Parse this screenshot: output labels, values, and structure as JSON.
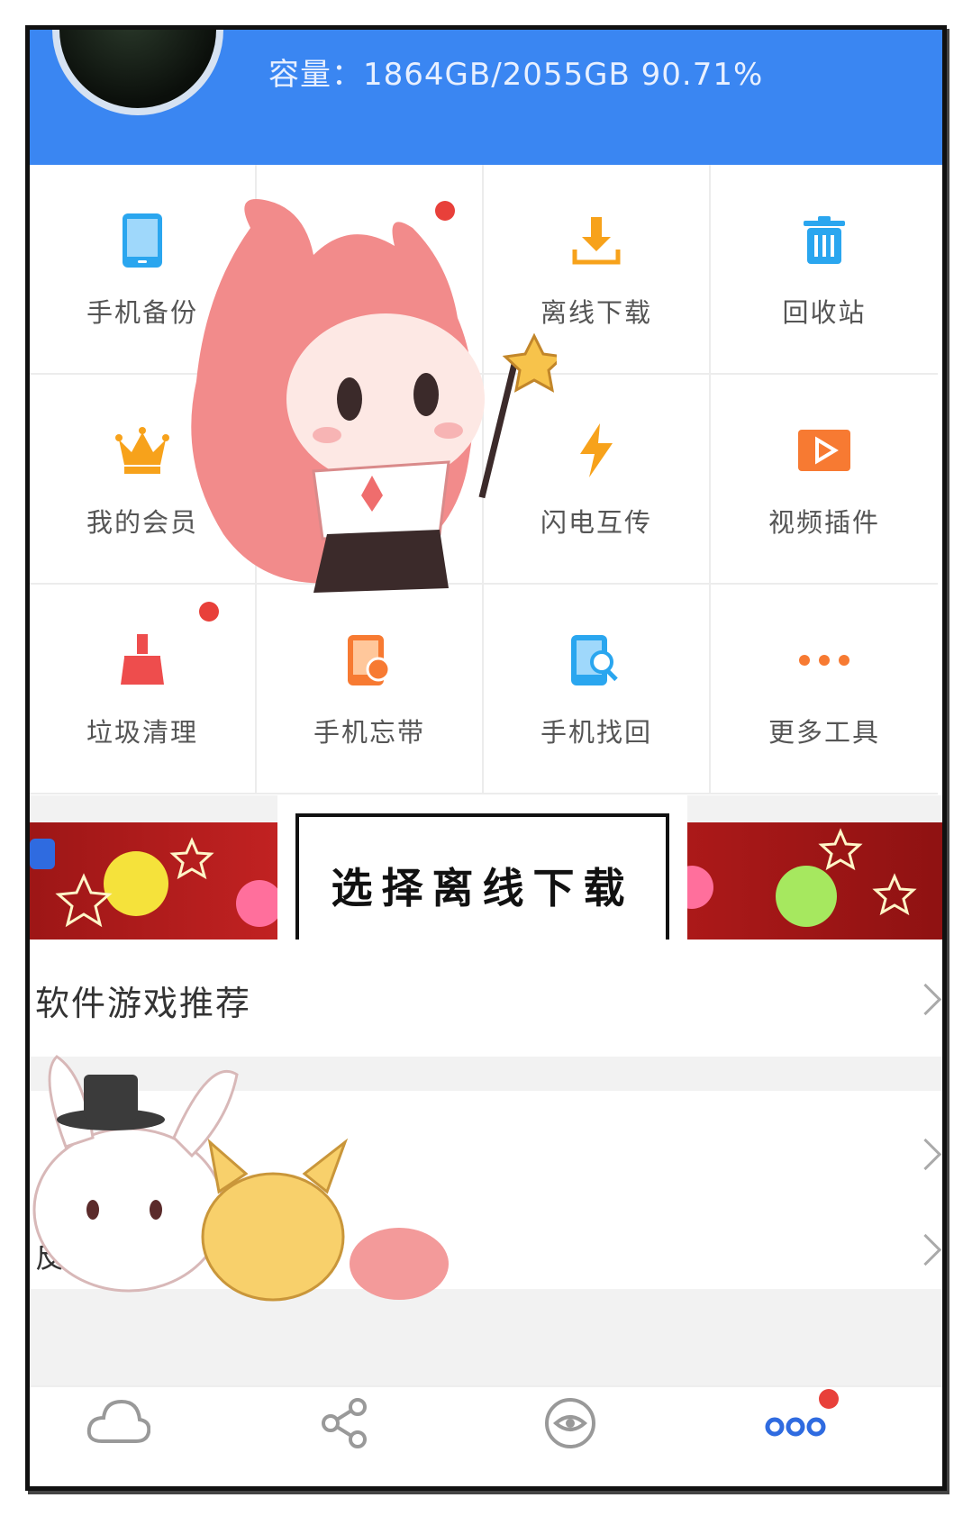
{
  "header": {
    "capacity_label": "容量：",
    "capacity_value": "1864GB/2055GB 90.71%"
  },
  "tools": [
    {
      "label": "手机备份",
      "icon": "phone-backup-icon"
    },
    {
      "label": "",
      "icon": "share-tool-icon"
    },
    {
      "label": "离线下载",
      "icon": "download-icon"
    },
    {
      "label": "回收站",
      "icon": "trash-icon"
    },
    {
      "label": "我的会员",
      "icon": "crown-icon"
    },
    {
      "label": "",
      "icon": "unknown-tool-icon"
    },
    {
      "label": "闪电互传",
      "icon": "lightning-icon"
    },
    {
      "label": "视频插件",
      "icon": "video-play-icon"
    },
    {
      "label": "垃圾清理",
      "icon": "broom-icon"
    },
    {
      "label": "手机忘带",
      "icon": "phone-forgot-icon"
    },
    {
      "label": "手机找回",
      "icon": "phone-search-icon"
    },
    {
      "label": "更多工具",
      "icon": "more-dots-icon"
    }
  ],
  "banner": {
    "callout": "选择离线下载"
  },
  "rows": [
    {
      "label": "软件游戏推荐"
    },
    {
      "label": ""
    },
    {
      "label": "反"
    }
  ],
  "tabbar": {
    "tabs": [
      {
        "icon": "cloud-icon",
        "label": ""
      },
      {
        "icon": "share-icon",
        "label": ""
      },
      {
        "icon": "eye-icon",
        "label": ""
      },
      {
        "icon": "more-icon",
        "label": ""
      }
    ]
  },
  "colors": {
    "header_blue": "#3a86f2",
    "accent_orange": "#f7a21b",
    "accent_blue": "#2aa6ef",
    "badge_red": "#e8403a"
  }
}
